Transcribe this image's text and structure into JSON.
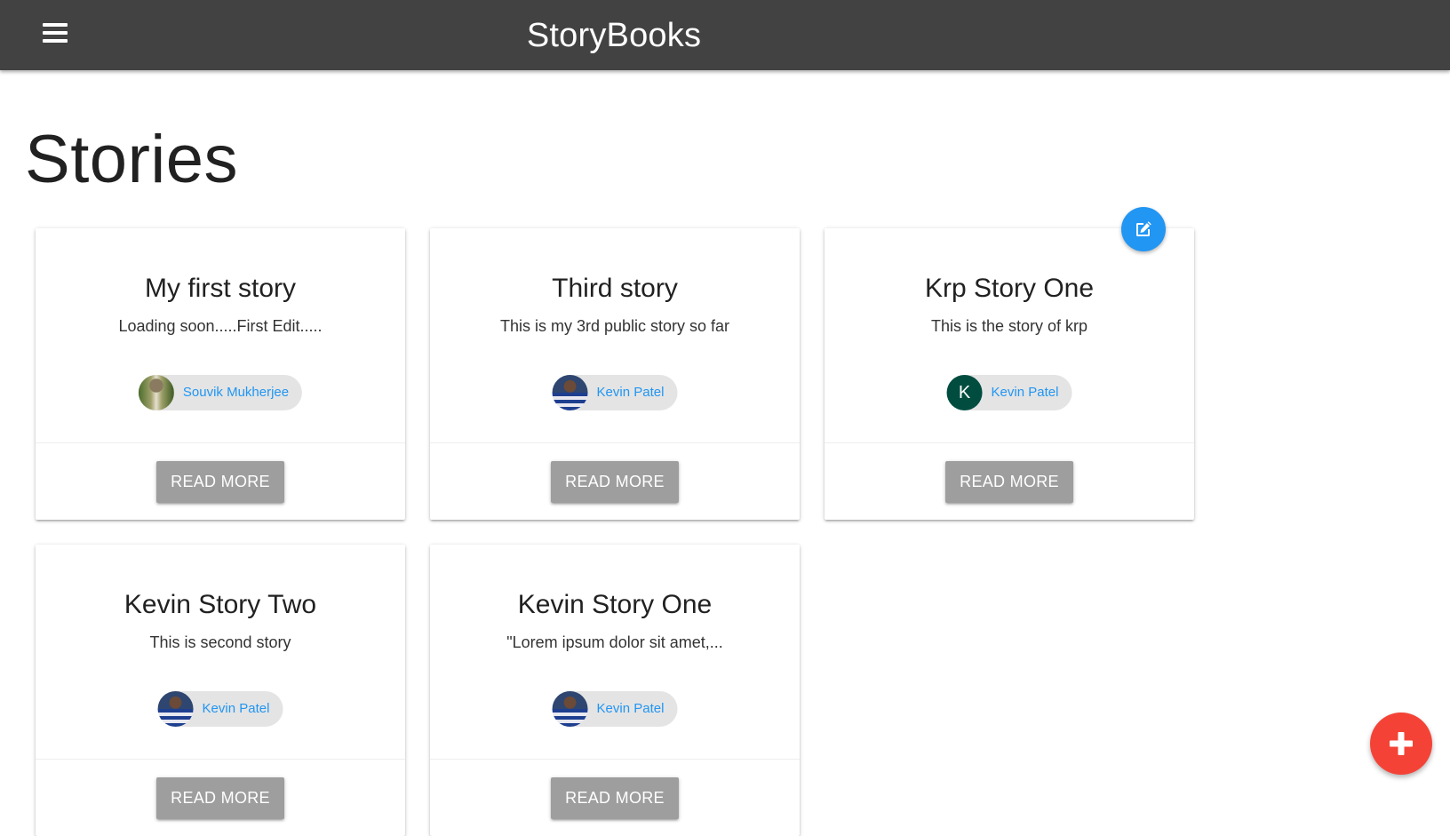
{
  "navbar": {
    "brand": "StoryBooks",
    "menu_icon": "hamburger-menu-icon"
  },
  "page": {
    "title": "Stories"
  },
  "stories": [
    {
      "title": "My first story",
      "body": "Loading soon.....First Edit.....",
      "author": "Souvik Mukherjee",
      "avatar": "photo",
      "button": "READ MORE"
    },
    {
      "title": "Third story",
      "body": "This is my 3rd public story so far",
      "author": "Kevin Patel",
      "avatar": "photo",
      "button": "READ MORE"
    },
    {
      "title": "Krp Story One",
      "body": "This is the story of krp",
      "author": "Kevin Patel",
      "avatar": "letter",
      "avatar_letter": "K",
      "button": "READ MORE",
      "editable": true
    },
    {
      "title": "Kevin Story Two",
      "body": "This is second story",
      "author": "Kevin Patel",
      "avatar": "photo",
      "button": "READ MORE"
    },
    {
      "title": "Kevin Story One",
      "body": "\"Lorem ipsum dolor sit amet,...",
      "author": "Kevin Patel",
      "avatar": "photo",
      "button": "READ MORE"
    }
  ],
  "fabs": {
    "edit_icon": "edit-icon",
    "add_icon": "add-icon"
  },
  "colors": {
    "navbar": "#424242",
    "link": "#2196f3",
    "button": "#9e9e9e",
    "edit_fab": "#2196f3",
    "add_fab": "#f44336",
    "letter_avatar": "#004d40"
  }
}
